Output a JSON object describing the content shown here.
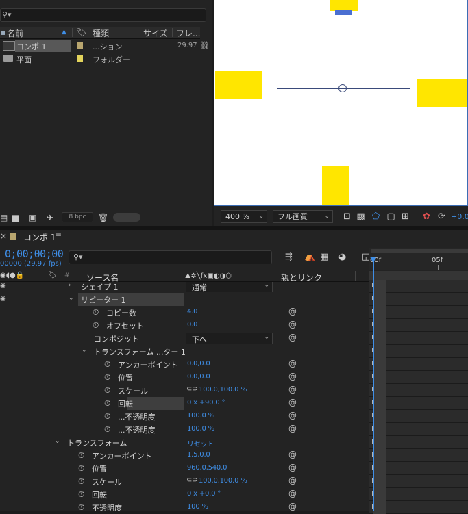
{
  "project": {
    "headers": {
      "name": "名前",
      "type": "種類",
      "size": "サイズ",
      "frame": "フレ..."
    },
    "items": [
      {
        "name": "コンポ 1",
        "type": "...ション",
        "fps": "29.97",
        "color": "#b9a66f",
        "icon": "composition-icon"
      },
      {
        "name": "平面",
        "type": "フォルダー",
        "fps": "",
        "color": "#e3d45c",
        "icon": "folder-icon"
      }
    ],
    "bpc": "8 bpc"
  },
  "viewer": {
    "zoom": "400 %",
    "quality": "フル画質",
    "exposure": "+0.0"
  },
  "timeline": {
    "tab_label": "コンポ 1",
    "timecode": "0;00;00;00",
    "fps_label": "00000 (29.97 fps)",
    "col_source": "ソース名",
    "col_parent": "親とリンク",
    "ruler_start": "00f",
    "ruler_mid": "05f",
    "rows": [
      {
        "label": "シェイプ 1",
        "indent": 118,
        "twirl": "›",
        "dropdown": "通常"
      },
      {
        "label": "リピーター 1",
        "indent": 118,
        "twirl": "⌄",
        "highlight": true
      },
      {
        "label": "コピー数",
        "indent": 155,
        "stopwatch": true,
        "value": "4.0",
        "link": true
      },
      {
        "label": "オフセット",
        "indent": 155,
        "stopwatch": true,
        "value": "0.0",
        "link": true
      },
      {
        "label": "コンポジット",
        "indent": 137,
        "dropdown": "下へ",
        "link": true
      },
      {
        "label": "トランスフォーム ...ター 1",
        "indent": 137,
        "twirl": "⌄"
      },
      {
        "label": "アンカーポイント",
        "indent": 172,
        "stopwatch": true,
        "value": "0.0,0.0",
        "link": true
      },
      {
        "label": "位置",
        "indent": 172,
        "stopwatch": true,
        "value": "0.0,0.0",
        "link": true
      },
      {
        "label": "スケール",
        "indent": 172,
        "stopwatch": true,
        "value": "100.0,100.0 %",
        "chain": true,
        "link": true
      },
      {
        "label": "回転",
        "indent": 172,
        "stopwatch": true,
        "value": "0 x +90.0 °",
        "link": true,
        "highlight_label": true
      },
      {
        "label": "...不透明度",
        "indent": 172,
        "stopwatch": true,
        "value": "100.0 %",
        "link": true
      },
      {
        "label": "...不透明度",
        "indent": 172,
        "stopwatch": true,
        "value": "100.0 %",
        "link": true
      },
      {
        "label": "トランスフォーム",
        "indent": 98,
        "twirl": "⌄",
        "value": "リセット"
      },
      {
        "label": "アンカーポイント",
        "indent": 134,
        "stopwatch": true,
        "value": "1.5,0.0",
        "link": true
      },
      {
        "label": "位置",
        "indent": 134,
        "stopwatch": true,
        "value": "960.0,540.0",
        "link": true
      },
      {
        "label": "スケール",
        "indent": 134,
        "stopwatch": true,
        "value": "100.0,100.0 %",
        "chain": true,
        "link": true
      },
      {
        "label": "回転",
        "indent": 134,
        "stopwatch": true,
        "value": "0 x +0.0 °",
        "link": true
      },
      {
        "label": "不透明度",
        "indent": 134,
        "stopwatch": true,
        "value": "100 %",
        "link": true
      }
    ]
  },
  "colors": {
    "accent": "#3f8ee6",
    "shape_yellow": "#ffe600",
    "panel": "#232323"
  }
}
